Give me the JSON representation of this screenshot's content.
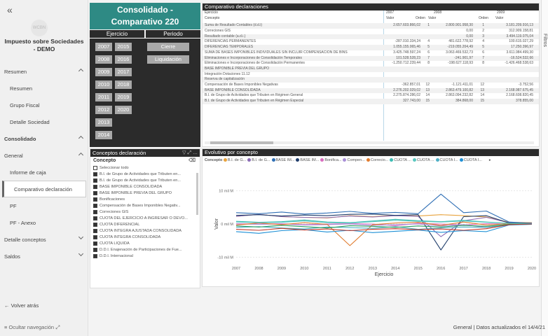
{
  "sidebar": {
    "collapse_icon": "«",
    "logo_text": "WCBN",
    "report_title": "Impuesto sobre Sociedades - DEMO",
    "items": [
      {
        "label": "Resumen",
        "type": "section",
        "chevron": "up"
      },
      {
        "label": "Resumen",
        "type": "child"
      },
      {
        "label": "Grupo Fiscal",
        "type": "child"
      },
      {
        "label": "Detalle Sociedad",
        "type": "child"
      },
      {
        "label": "Consolidado",
        "type": "section-bold",
        "chevron": "up"
      },
      {
        "label": "General",
        "type": "section",
        "chevron": "up"
      },
      {
        "label": "Informe de caja",
        "type": "child"
      },
      {
        "label": "Comparativo declaración",
        "type": "active"
      },
      {
        "label": "PF",
        "type": "child"
      },
      {
        "label": "PF - Anexo",
        "type": "child"
      },
      {
        "label": "Detalle conceptos",
        "type": "section",
        "chevron": "down"
      },
      {
        "label": "Saldos",
        "type": "section",
        "chevron": "down"
      }
    ],
    "back_label": "Volver atrás",
    "hide_label": "Ocultar navegación"
  },
  "title_card": {
    "line1": "Consolidado -",
    "line2": "Comparativo 220"
  },
  "slicer": {
    "ejercicio_label": "Ejercicio",
    "periodo_label": "Periodo",
    "years_col1": [
      "2007",
      "2008",
      "2009",
      "2010",
      "2011",
      "2012",
      "2013",
      "2014"
    ],
    "years_col2": [
      "2015",
      "2016",
      "2017",
      "2018",
      "2019",
      "2020"
    ],
    "periods": [
      "Cierre",
      "Liquidación"
    ]
  },
  "concepts": {
    "title": "Conceptos declaración",
    "label": "Concepto",
    "items": [
      {
        "label": "Seleccionar todo",
        "checked": false
      },
      {
        "label": "B.I. de Grupo de Actividades que Tributen en...",
        "checked": true
      },
      {
        "label": "B.I. de Grupo de Actividades que Tributen en...",
        "checked": true
      },
      {
        "label": "BASE IMPONIBLE CONSOLIDADA",
        "checked": true
      },
      {
        "label": "BASE IMPONIBLE PREVIA DEL GRUPO",
        "checked": true
      },
      {
        "label": "Bonificaciones",
        "checked": true
      },
      {
        "label": "Compensación de Bases Imponibles Negativ...",
        "checked": true
      },
      {
        "label": "Correciones GIS",
        "checked": true
      },
      {
        "label": "CUOTA DEL EJERCICIO A INGRESAR O DEVO...",
        "checked": true
      },
      {
        "label": "CUOTA DIFERENCIAL",
        "checked": true
      },
      {
        "label": "CUOTA INTEGRA AJUSTADA CONSOLIDADA",
        "checked": true
      },
      {
        "label": "CUOTA INTEGRA CONSOLIDADA",
        "checked": true
      },
      {
        "label": "CUOTA LIQUIDA",
        "checked": true
      },
      {
        "label": "D.D.I. Enajenación de Participaciones de Fue...",
        "checked": true
      },
      {
        "label": "D.D.I. Internacional",
        "checked": true
      }
    ]
  },
  "table": {
    "title": "Comparativo declaraciones",
    "header1": {
      "c0": "Ejercicio",
      "y1": "2007",
      "y2": "2008",
      "y3": "2009"
    },
    "header2": {
      "c0": "Concepto",
      "v1": "Valor",
      "o2": "Orden",
      "v2": "Valor",
      "o3": "Orden",
      "v3": "Valor"
    },
    "rows": [
      [
        "Suma de Resultado Contables (d.d.i)",
        "2.657.603.866,02",
        "1",
        "2.800.901.958,30",
        "1",
        "3.181.209.916,13"
      ],
      [
        "Correciones GIS",
        "",
        "",
        "0,00",
        "2",
        "312.909.158,81"
      ],
      [
        "Resultado contable (a.d.i.)",
        "",
        "",
        "0,00",
        "3",
        "3.494.119.075,04"
      ],
      [
        "DIFERENCIAS PERMANENTES",
        "-287.010.334,24",
        "4",
        "481.622.778,92",
        "4",
        "100.615.027,29"
      ],
      [
        "DIFERENCIAS TEMPORALES",
        "1.055.155.065,46",
        "5",
        "-219.055.204,49",
        "5",
        "17.250.396,97"
      ],
      [
        "SUMA DE BASES IMPONIBLES INDIVIDUALES SIN INCLUIR COMPENSACIÓN DE BINS",
        "3.425.748.597,24",
        "6",
        "3.063.469.532,73",
        "6",
        "3.611.984.499,30"
      ],
      [
        "Eliminaciones e Incorporaciones de Consolidación Temporales",
        "101.528.528,23",
        "7",
        "-241.901,97",
        "7",
        "-16.524.532,66"
      ],
      [
        "Eliminaciones e Incorporaciones de Consolidación Permanentes",
        "-1.250.712.239,44",
        "8",
        "-198.627.118,93",
        "8",
        "-1.426.468.538,63"
      ],
      [
        "BASE IMPONIBLE PREVIA DEL GRUPO",
        "",
        "",
        "",
        "",
        ""
      ],
      [
        "Integración Dotaciones 11.12",
        "",
        "",
        "",
        "",
        ""
      ],
      [
        "Reserva de capitalización",
        "",
        "",
        "",
        "",
        ""
      ],
      [
        "Compensación de Bases Imponibles Negativas",
        "-362.857,01",
        "12",
        "-1.121.411,01",
        "12",
        "-3.752,56"
      ],
      [
        "BASE IMPONIBLE CONSOLIDADA",
        "2.276.202.029,02",
        "13",
        "2.863.479.100,82",
        "13",
        "2.168.987.675,45"
      ],
      [
        "B.I. de Grupo de Actividades que Tributen en Régimen General",
        "2.275.874.286,02",
        "14",
        "2.863.094.232,82",
        "14",
        "2.168.608.820,45"
      ],
      [
        "B.I. de Grupo de Actividades que Tributen en Régimen Especial",
        "327.743,00",
        "15",
        "384.868,00",
        "15",
        "378.855,00"
      ]
    ]
  },
  "chart": {
    "title": "Evolutivo por concepto",
    "legend_label": "Concepto",
    "legend": [
      {
        "name": "B.I. de G...",
        "color": "#e8a33d"
      },
      {
        "name": "B.I. de G...",
        "color": "#8b6bb5"
      },
      {
        "name": "BASE IM...",
        "color": "#2f6fb5"
      },
      {
        "name": "BASE IM...",
        "color": "#1f3d6b"
      },
      {
        "name": "Bonifica...",
        "color": "#d96fc0"
      },
      {
        "name": "Compen...",
        "color": "#a98fd8"
      },
      {
        "name": "Correcio...",
        "color": "#e07b2e"
      },
      {
        "name": "CUOTA ...",
        "color": "#3cbcb4"
      },
      {
        "name": "CUOTA ...",
        "color": "#5cc8c0"
      },
      {
        "name": "CUOTA I...",
        "color": "#4fb0c6"
      },
      {
        "name": "CUOTA I...",
        "color": "#1e90d6"
      }
    ],
    "more_icon": "▸"
  },
  "chart_data": {
    "type": "line",
    "title": "Evolutivo por concepto",
    "xlabel": "Ejercicio",
    "ylabel": "Valor",
    "x": [
      "2007",
      "2008",
      "2009",
      "2010",
      "2011",
      "2012",
      "2013",
      "2014",
      "2015",
      "2016",
      "2017",
      "2018",
      "2019",
      "2020"
    ],
    "yticks": [
      {
        "v": 10,
        "label": "10 mil M"
      },
      {
        "v": 0,
        "label": "0 mil M"
      },
      {
        "v": -10,
        "label": "-10 mil M"
      }
    ],
    "ylim": [
      -12,
      12
    ],
    "series": [
      {
        "color": "#e8a33d",
        "values": [
          2.3,
          2.9,
          2.2,
          2.0,
          1.8,
          2.5,
          2.2,
          2.6,
          2.4,
          2.8,
          2.5,
          2.1,
          0.5,
          0.4
        ]
      },
      {
        "color": "#8b6bb5",
        "values": [
          2.3,
          2.9,
          2.2,
          2.0,
          1.9,
          2.4,
          2.1,
          2.5,
          2.3,
          -3.8,
          1.0,
          2.0,
          0.4,
          0.3
        ]
      },
      {
        "color": "#2f6fb5",
        "values": [
          3.4,
          3.1,
          3.6,
          3.0,
          3.3,
          3.8,
          3.2,
          3.5,
          3.1,
          9.0,
          3.4,
          3.9,
          0.6,
          0.2
        ]
      },
      {
        "color": "#1f3d6b",
        "values": [
          2.6,
          2.8,
          2.4,
          2.7,
          2.5,
          2.9,
          3.0,
          2.6,
          2.8,
          -7.8,
          2.2,
          2.5,
          0.3,
          0.1
        ]
      },
      {
        "color": "#d96fc0",
        "values": [
          0.1,
          0.0,
          0.1,
          -0.2,
          0.0,
          0.1,
          0.0,
          -0.5,
          0.2,
          0.0,
          -0.3,
          0.1,
          0.0,
          0.0
        ]
      },
      {
        "color": "#a98fd8",
        "values": [
          0.0,
          -0.1,
          0.0,
          -0.3,
          -0.2,
          0.0,
          -0.4,
          -0.2,
          0.0,
          -0.6,
          -0.2,
          -1.0,
          0.0,
          0.0
        ]
      },
      {
        "color": "#e07b2e",
        "values": [
          -0.3,
          0.3,
          -0.2,
          0.4,
          -0.1,
          -6.5,
          -0.2,
          0.3,
          0.5,
          -0.4,
          0.6,
          -0.3,
          0.1,
          0.0
        ]
      },
      {
        "color": "#3cbcb4",
        "values": [
          0.8,
          0.5,
          0.7,
          1.2,
          0.6,
          0.4,
          0.9,
          1.4,
          1.0,
          0.7,
          1.1,
          0.6,
          0.2,
          0.1
        ]
      },
      {
        "color": "#5cc8c0",
        "values": [
          0.6,
          0.4,
          0.5,
          0.9,
          0.4,
          0.3,
          0.7,
          1.1,
          0.8,
          0.6,
          0.9,
          0.5,
          0.2,
          0.1
        ]
      },
      {
        "color": "#4fb0c6",
        "values": [
          -1.0,
          -0.8,
          -1.2,
          -1.5,
          -0.9,
          -1.1,
          -1.3,
          -0.8,
          -1.6,
          -1.2,
          -0.9,
          -1.0,
          -0.2,
          -0.1
        ]
      },
      {
        "color": "#1e90d6",
        "values": [
          -2.3,
          -2.8,
          -2.0,
          -1.7,
          -2.4,
          -1.9,
          -2.6,
          -2.2,
          -1.8,
          -2.5,
          -2.0,
          -2.3,
          -0.3,
          -0.1
        ]
      },
      {
        "color": "#2a9d5c",
        "values": [
          -0.6,
          -0.9,
          -0.4,
          -0.8,
          -1.2,
          -0.5,
          -0.7,
          -1.0,
          -0.6,
          -0.9,
          -0.4,
          -0.7,
          -0.1,
          0.0
        ]
      },
      {
        "color": "#c0392b",
        "values": [
          -1.6,
          -1.9,
          -1.3,
          -1.8,
          -1.5,
          -2.0,
          -1.6,
          -1.4,
          -1.7,
          -1.5,
          -1.9,
          -1.4,
          -0.2,
          0.0
        ]
      }
    ]
  },
  "filters_label": "Filtros",
  "status": {
    "text": "General  |  Datos actualizados el 14/4/21"
  }
}
